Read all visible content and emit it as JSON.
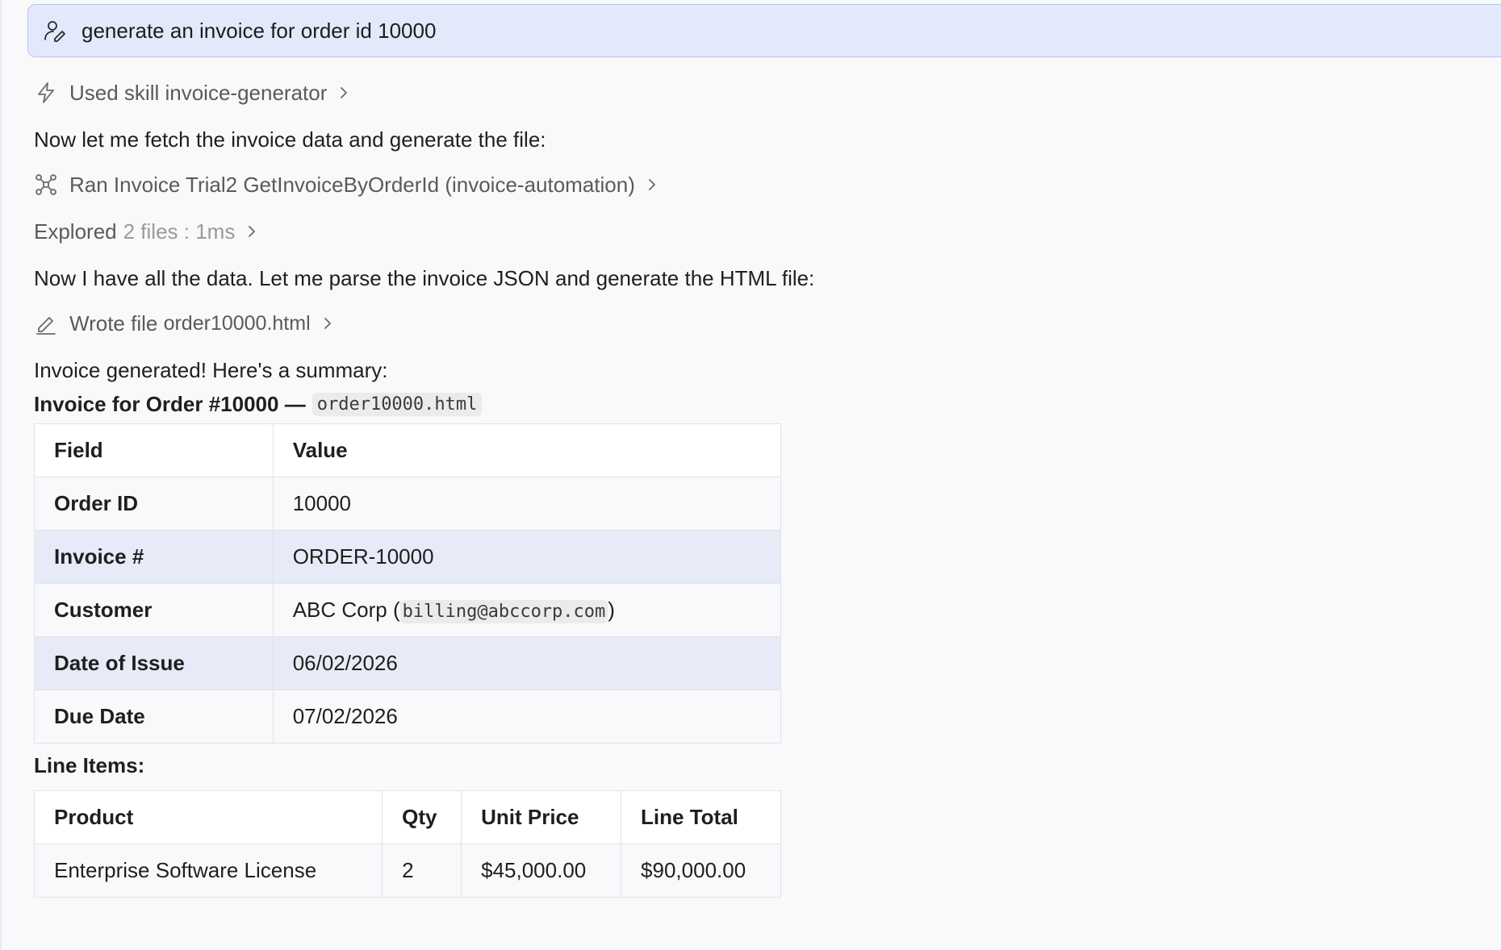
{
  "prompt": {
    "text": "generate an invoice for order id 10000"
  },
  "steps": {
    "skill": {
      "prefix": "Used skill",
      "name": "invoice-generator"
    },
    "fetch_text": "Now let me fetch the invoice data and generate the file:",
    "ran": {
      "text": "Ran Invoice Trial2 GetInvoiceByOrderId (invoice-automation)"
    },
    "explored": {
      "label": "Explored",
      "detail": "2 files : 1ms"
    },
    "parse_text": "Now I have all the data. Let me parse the invoice JSON and generate the HTML file:",
    "wrote": {
      "prefix": "Wrote file",
      "filename": "order10000.html"
    },
    "summary_text": "Invoice generated! Here's a summary:"
  },
  "invoice": {
    "heading": "Invoice for Order #10000 —",
    "file_code": "order10000.html",
    "table": {
      "headers": [
        "Field",
        "Value"
      ],
      "rows": [
        {
          "field": "Order ID",
          "value": "10000"
        },
        {
          "field": "Invoice #",
          "value": "ORDER-10000"
        },
        {
          "field": "Customer",
          "value_prefix": "ABC Corp (",
          "value_code": "billing@abccorp.com",
          "value_suffix": ")"
        },
        {
          "field": "Date of Issue",
          "value": "06/02/2026"
        },
        {
          "field": "Due Date",
          "value": "07/02/2026"
        }
      ]
    },
    "line_items_label": "Line Items:",
    "line_items": {
      "headers": [
        "Product",
        "Qty",
        "Unit Price",
        "Line Total"
      ],
      "rows": [
        {
          "product": "Enterprise Software License",
          "qty": "2",
          "unit_price": "$45,000.00",
          "line_total": "$90,000.00"
        }
      ]
    }
  }
}
